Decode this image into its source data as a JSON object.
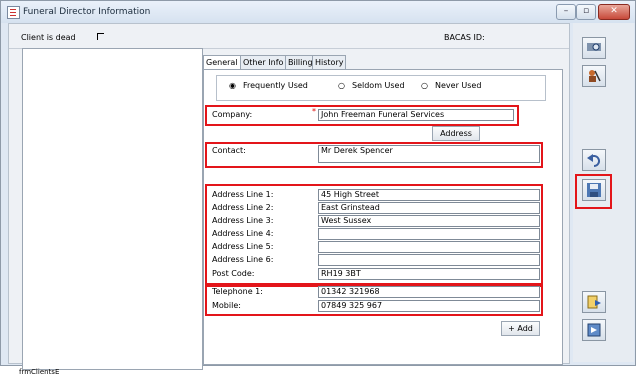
{
  "window": {
    "title": "Funeral Director Information",
    "buttons": [
      "minimize",
      "restore",
      "close"
    ]
  },
  "header": {
    "client_is_dead_label": "Client is dead",
    "bacas_label": "BACAS ID:"
  },
  "tabs": [
    {
      "label": "General",
      "active": true
    },
    {
      "label": "Other Info",
      "underline": "O"
    },
    {
      "label": "Billing",
      "underline": "B"
    },
    {
      "label": "History",
      "underline": "H"
    }
  ],
  "usage_filter": {
    "options": [
      "Frequently Used",
      "Seldom Used",
      "Never Used"
    ],
    "selected": "Frequently Used"
  },
  "form": {
    "company_label": "Company:",
    "required_marker": "*",
    "company_value": "John Freeman Funeral Services",
    "address_button": "Address",
    "contact_label": "Contact:",
    "contact_value": "Mr Derek Spencer",
    "address_lines": [
      {
        "label": "Address Line 1:",
        "value": "45 High Street"
      },
      {
        "label": "Address Line 2:",
        "value": "East Grinstead"
      },
      {
        "label": "Address Line 3:",
        "value": "West Sussex"
      },
      {
        "label": "Address Line 4:",
        "value": ""
      },
      {
        "label": "Address Line 5:",
        "value": ""
      },
      {
        "label": "Address Line 6:",
        "value": ""
      },
      {
        "label": "Post Code:",
        "value": "RH19 3BT"
      }
    ],
    "telephone_label": "Telephone 1:",
    "telephone_value": "01342 321968",
    "mobile_label": "Mobile:",
    "mobile_value": "07849 325 967",
    "add_button": "+ Add"
  },
  "status_bar": "frmClientsE",
  "toolbar_icons": [
    "search-icon",
    "find-user-icon",
    "undo-icon",
    "save-icon",
    "exit-icon",
    "close-form-icon"
  ],
  "colors": {
    "highlight": "#e3151a",
    "window_bg": "#dfe8f3"
  }
}
